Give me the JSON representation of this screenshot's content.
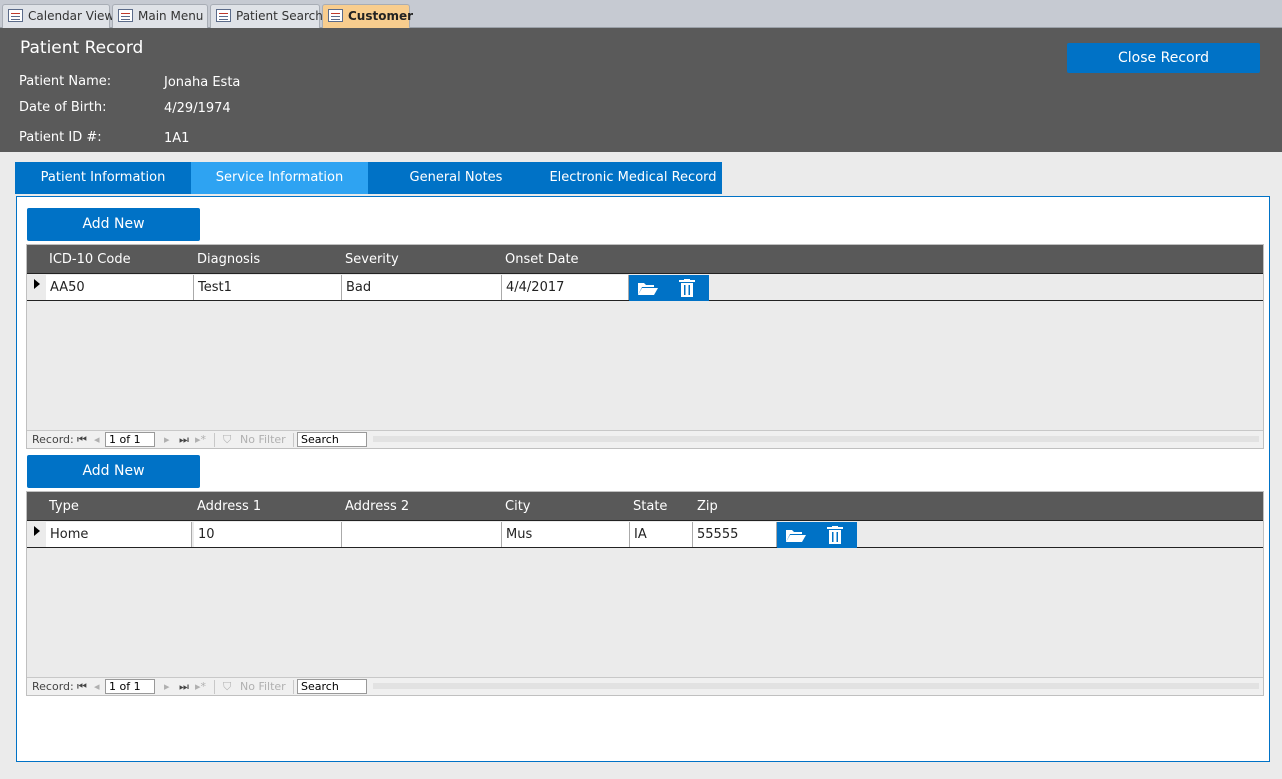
{
  "doc_tabs": [
    {
      "label": "Calendar View",
      "active": false
    },
    {
      "label": "Main Menu",
      "active": false
    },
    {
      "label": "Patient Search",
      "active": false
    },
    {
      "label": "Customer",
      "active": true
    }
  ],
  "header": {
    "title": "Patient Record",
    "close_button": "Close Record",
    "fields": [
      {
        "label": "Patient Name:",
        "value": "Jonaha Esta"
      },
      {
        "label": "Date of Birth:",
        "value": "4/29/1974"
      },
      {
        "label": "Patient ID #:",
        "value": "1A1"
      }
    ]
  },
  "tabs": [
    {
      "label": "Patient Information",
      "active": false
    },
    {
      "label": "Service Information",
      "active": true
    },
    {
      "label": "General Notes",
      "active": false
    },
    {
      "label": "Electronic Medical Record",
      "active": false
    }
  ],
  "diagnosis_section": {
    "add_button": "Add New",
    "columns": [
      "ICD-10 Code",
      "Diagnosis",
      "Severity",
      "Onset Date"
    ],
    "rows": [
      [
        "AA50",
        "Test1",
        "Bad",
        "4/4/2017"
      ]
    ],
    "nav": {
      "record_label": "Record:",
      "record_value": "1 of 1",
      "filter": "No Filter",
      "search": "Search"
    }
  },
  "address_section": {
    "add_button": "Add New",
    "columns": [
      "Type",
      "Address 1",
      "Address 2",
      "City",
      "State",
      "Zip"
    ],
    "rows": [
      [
        "Home",
        "10",
        "",
        "Mus",
        "IA",
        "55555"
      ]
    ],
    "nav": {
      "record_label": "Record:",
      "record_value": "1 of 1",
      "filter": "No Filter",
      "search": "Search"
    }
  },
  "icons": {
    "folder": "folder-open-icon",
    "trash": "trash-icon",
    "form": "form-icon"
  },
  "colors": {
    "accent": "#0072c6",
    "active_tab": "#2ea3f2",
    "header_bg": "#5a5a5a",
    "active_doc_tab": "#f8cd8e"
  }
}
